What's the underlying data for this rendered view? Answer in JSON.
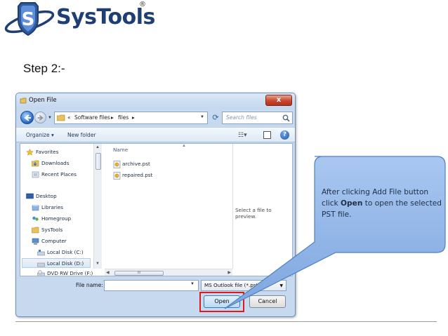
{
  "brand": {
    "name": "SysTools",
    "registered_mark": "®",
    "colors": {
      "blue": "#1f3e73",
      "accent": "#2a6cc4"
    }
  },
  "slide": {
    "step_title": "Step 2:-"
  },
  "dialog": {
    "title": "Open File",
    "close_glyph": "x",
    "breadcrumb": [
      "«",
      "Software files",
      "▸",
      "files",
      "▸"
    ],
    "search_placeholder": "Search files",
    "toolbar": {
      "organize": "Organize ▾",
      "new_folder": "New folder",
      "help": "?"
    },
    "nav_items": [
      {
        "label": "Favorites",
        "icon": "star-icon"
      },
      {
        "label": "Downloads",
        "icon": "downloads-folder-icon"
      },
      {
        "label": "Recent Places",
        "icon": "recent-places-icon"
      },
      {
        "label": "Desktop",
        "icon": "desktop-icon"
      },
      {
        "label": "Libraries",
        "icon": "libraries-icon"
      },
      {
        "label": "Homegroup",
        "icon": "homegroup-icon"
      },
      {
        "label": "SysTools",
        "icon": "folder-icon"
      },
      {
        "label": "Computer",
        "icon": "computer-icon"
      },
      {
        "label": "Local Disk (C:)",
        "icon": "drive-icon"
      },
      {
        "label": "Local Disk (D:)",
        "icon": "drive-icon"
      },
      {
        "label": "DVD RW Drive (F:)",
        "icon": "dvd-drive-icon"
      }
    ],
    "column_name": "Name",
    "files": [
      "archive.pst",
      "repaired.pst"
    ],
    "preview_text": "Select a file to preview.",
    "scroll_thumb_text": "III",
    "file_name_label": "File name:",
    "file_name_value": "",
    "filter_value": "MS Outlook file (*.pst)",
    "open_label": "Open",
    "cancel_label": "Cancel"
  },
  "callout": {
    "text_before": "After clicking Add File button click ",
    "text_bold": "Open",
    "text_after": " to open the selected PST file.",
    "fill_color": "#8fb4e8",
    "border_color": "#4f81bd"
  }
}
